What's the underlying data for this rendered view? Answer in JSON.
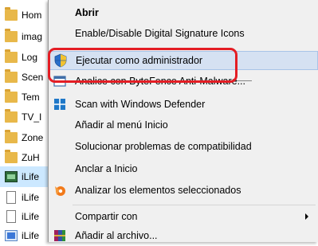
{
  "file_list": {
    "rows": [
      {
        "name": "Hom",
        "icon": "folder-icon"
      },
      {
        "name": "imag",
        "icon": "folder-icon"
      },
      {
        "name": "Log",
        "icon": "folder-icon"
      },
      {
        "name": "Scen",
        "icon": "folder-icon"
      },
      {
        "name": "Tem",
        "icon": "folder-icon"
      },
      {
        "name": "TV_I",
        "icon": "folder-icon"
      },
      {
        "name": "Zone",
        "icon": "folder-icon"
      },
      {
        "name": "ZuH",
        "icon": "folder-icon"
      },
      {
        "name": "iLife",
        "icon": "app-icon"
      },
      {
        "name": "iLife",
        "icon": "document-icon"
      },
      {
        "name": "iLife",
        "icon": "document-icon"
      },
      {
        "name": "iLife",
        "icon": "window-icon"
      }
    ]
  },
  "menu": {
    "open": "Abrir",
    "digital_signature": "Enable/Disable Digital Signature Icons",
    "run_as_admin": "Ejecutar como administrador",
    "bytefence": "Analice con ByteFence Anti-Malware...",
    "defender": "Scan with Windows Defender",
    "add_start_menu": "Añadir al menú Inicio",
    "troubleshoot": "Solucionar problemas de compatibilidad",
    "pin_start": "Anclar a Inicio",
    "analyze_selected": "Analizar los elementos seleccionados",
    "share_with": "Compartir con",
    "add_archive": "Añadir al archivo..."
  },
  "colors": {
    "callout": "#e41d24",
    "highlight": "#d5e1f2",
    "menu_bg": "#f0f0f0"
  }
}
